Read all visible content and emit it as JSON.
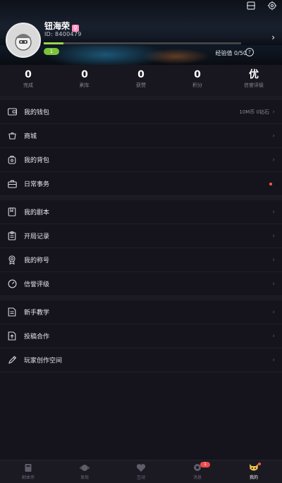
{
  "header": {
    "username": "钮海荣",
    "gender_badge": "♀",
    "user_id": "ID: 8400479",
    "level_label": "1",
    "level_progress": 0.1,
    "exp_label": "经验值 0/50",
    "help_icon": "question-circle-icon",
    "top_icons": [
      "scan-icon",
      "gear-icon"
    ]
  },
  "stats": [
    {
      "value": "0",
      "label": "完成"
    },
    {
      "value": "0",
      "label": "刷车"
    },
    {
      "value": "0",
      "label": "获赞"
    },
    {
      "value": "0",
      "label": "积分"
    },
    {
      "value": "优",
      "label": "信誉评级"
    }
  ],
  "menu": {
    "group1": [
      {
        "label": "我的钱包",
        "detail": "10M币 0钻石",
        "icon": "wallet-icon"
      },
      {
        "label": "商城",
        "detail": "",
        "icon": "store-icon"
      },
      {
        "label": "我的背包",
        "detail": "",
        "icon": "backpack-icon"
      },
      {
        "label": "日常事务",
        "detail": "",
        "icon": "briefcase-icon"
      }
    ],
    "group2": [
      {
        "label": "我的剧本",
        "detail": "",
        "icon": "book-icon"
      },
      {
        "label": "开局记录",
        "detail": "",
        "icon": "clipboard-icon"
      },
      {
        "label": "我的称号",
        "detail": "",
        "icon": "medal-icon"
      },
      {
        "label": "信誉评级",
        "detail": "",
        "icon": "gauge-icon"
      }
    ],
    "group3": [
      {
        "label": "新手教学",
        "detail": "",
        "icon": "tutorial-icon"
      },
      {
        "label": "投稿合作",
        "detail": "",
        "icon": "upload-document-icon"
      },
      {
        "label": "玩家创作空间",
        "detail": "",
        "icon": "pen-icon"
      }
    ]
  },
  "bottom_nav": [
    {
      "label": "剧本杀",
      "icon": "script-icon",
      "active": false
    },
    {
      "label": "发现",
      "icon": "planet-icon",
      "active": false
    },
    {
      "label": "互动",
      "icon": "heart-icon",
      "active": false
    },
    {
      "label": "消息",
      "icon": "chat-icon",
      "active": false,
      "badge": "1"
    },
    {
      "label": "我的",
      "icon": "cat-face-icon",
      "active": true
    }
  ],
  "colors": {
    "background": "#15141c",
    "level_green": "#7cc23b",
    "alert_red": "#ff5a4a"
  }
}
